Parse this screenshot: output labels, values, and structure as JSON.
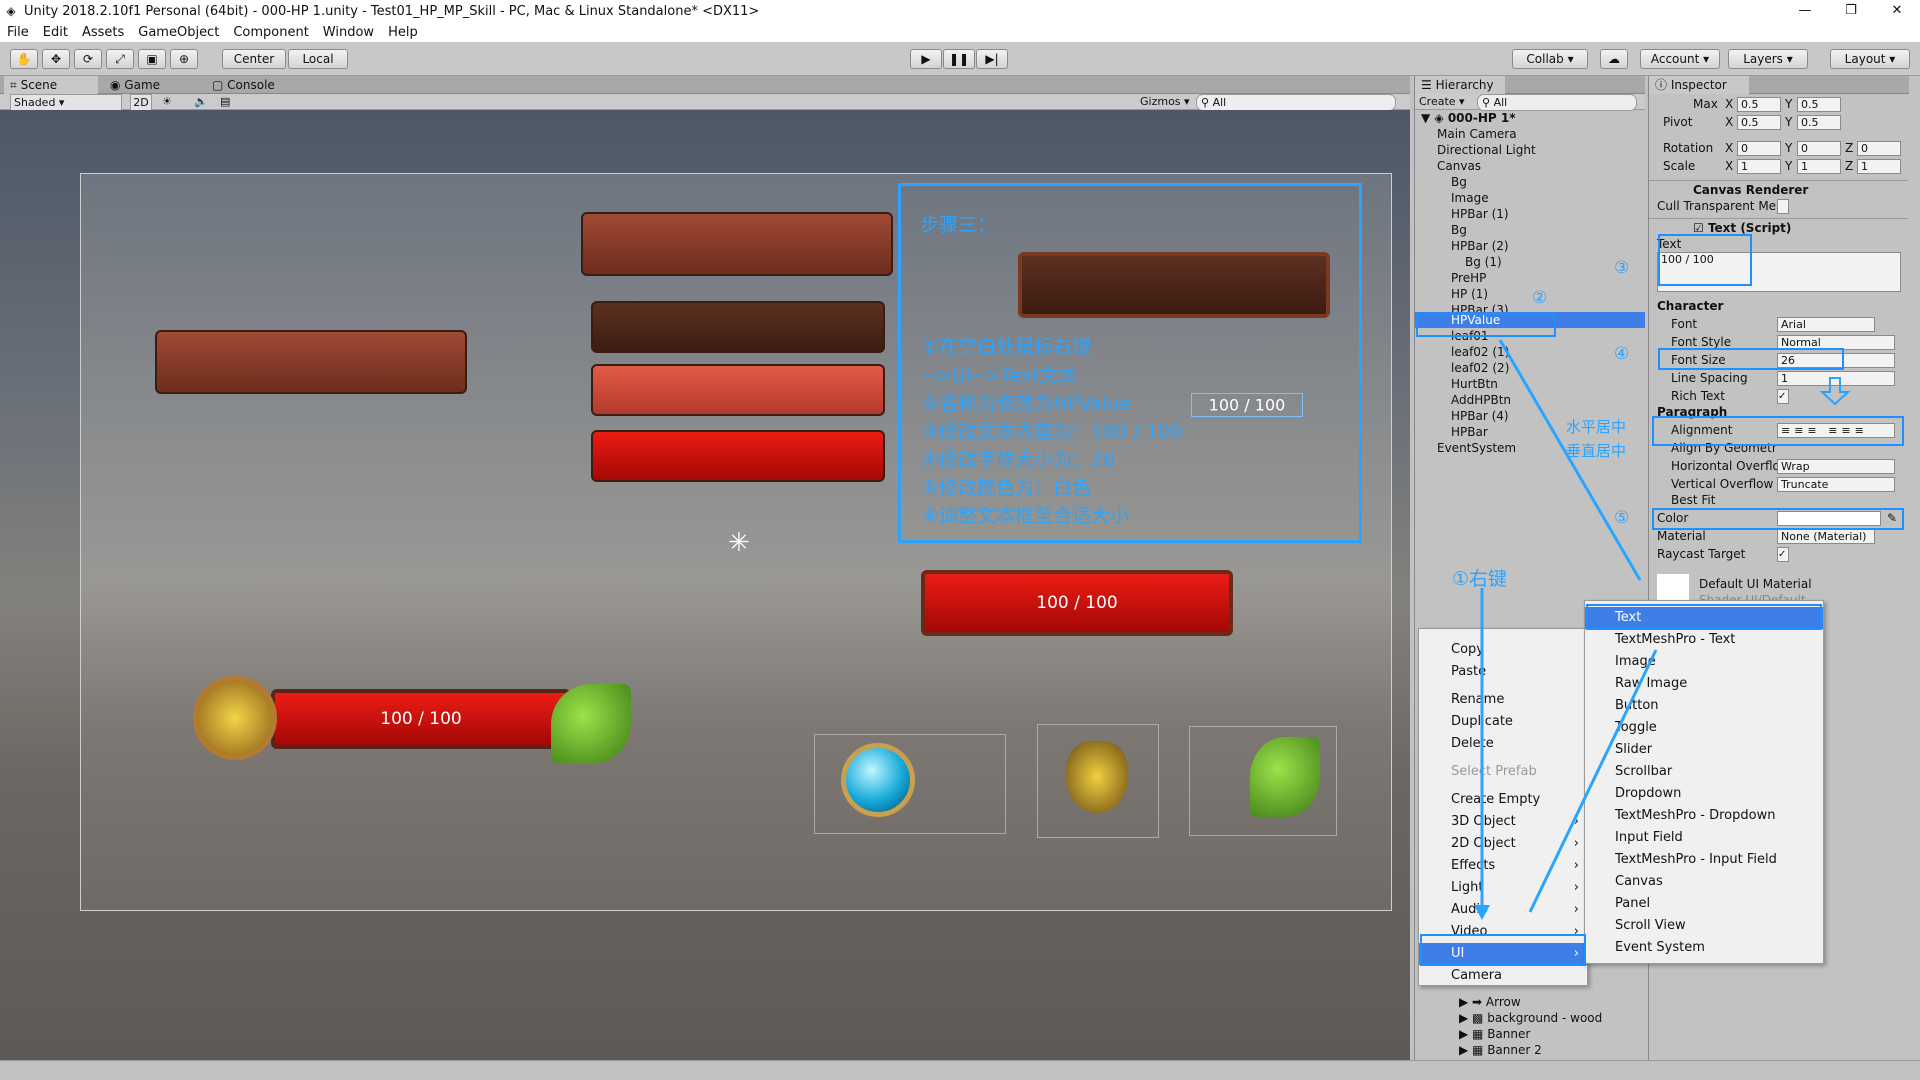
{
  "window": {
    "title": "Unity 2018.2.10f1 Personal (64bit) - 000-HP 1.unity - Test01_HP_MP_Skill - PC, Mac & Linux Standalone* <DX11>",
    "minimize": "—",
    "maximize": "❐",
    "close": "✕"
  },
  "menu": [
    "File",
    "Edit",
    "Assets",
    "GameObject",
    "Component",
    "Window",
    "Help"
  ],
  "toolbar": {
    "center": "Center",
    "local": "Local",
    "collab": "Collab ▾",
    "account": "Account",
    "layers": "Layers",
    "layout": "Layout"
  },
  "scene_tabs": {
    "scene": "Scene",
    "game": "Game",
    "console": "Console"
  },
  "scene_bar": {
    "shaded": "Shaded",
    "mode2d": "2D",
    "gizmos": "Gizmos",
    "search": "All"
  },
  "scene": {
    "hp_text_small": "100 / 100",
    "hp_text_big": "100 / 100",
    "hp_text_main": "100 / 100"
  },
  "annotation": {
    "title": "步骤三：",
    "lines": [
      "①在空白处鼠标右键",
      "-->UI-->Text文本",
      "②名称为修改为HPValue",
      "③修改文本内容为：100 / 100",
      "④修改字体大小为：26",
      "⑤修改颜色为：白色",
      "⑥调整文本框至合适大小"
    ],
    "mark1": "①右键",
    "mark2": "②",
    "mark3": "③",
    "mark4": "④",
    "mark5": "⑤",
    "align_note1": "水平居中",
    "align_note2": "垂直居中"
  },
  "hierarchy": {
    "tab": "Hierarchy",
    "create": "Create ▾",
    "search": "All",
    "scene_name": "000-HP 1*",
    "items": [
      {
        "label": "Main Camera",
        "indent": 1
      },
      {
        "label": "Directional Light",
        "indent": 1
      },
      {
        "label": "Canvas",
        "indent": 1
      },
      {
        "label": "Bg",
        "indent": 2
      },
      {
        "label": "Image",
        "indent": 2
      },
      {
        "label": "HPBar (1)",
        "indent": 2
      },
      {
        "label": "Bg",
        "indent": 2
      },
      {
        "label": "HPBar (2)",
        "indent": 2
      },
      {
        "label": "Bg (1)",
        "indent": 3
      },
      {
        "label": "PreHP",
        "indent": 2
      },
      {
        "label": "HP (1)",
        "indent": 2
      },
      {
        "label": "HPBar (3)",
        "indent": 2
      },
      {
        "label": "HPValue",
        "indent": 2,
        "selected": true
      },
      {
        "label": "leaf01",
        "indent": 2
      },
      {
        "label": "leaf02 (1)",
        "indent": 2
      },
      {
        "label": "leaf02 (2)",
        "indent": 2
      },
      {
        "label": "HurtBtn",
        "indent": 2
      },
      {
        "label": "AddHPBtn",
        "indent": 2
      },
      {
        "label": "HPBar (4)",
        "indent": 2
      },
      {
        "label": "HPBar",
        "indent": 2
      },
      {
        "label": "EventSystem",
        "indent": 1
      }
    ],
    "project_items": [
      "Arrow",
      "background - wood",
      "Banner",
      "Banner 2"
    ]
  },
  "inspector": {
    "tab": "Inspector",
    "rect": {
      "max_x": "0.5",
      "max_y": "0.5",
      "pivot_x": "0.5",
      "pivot_y": "0.5",
      "rot_x": "0",
      "rot_y": "0",
      "rot_z": "0",
      "scale_x": "1",
      "scale_y": "1",
      "scale_z": "1"
    },
    "labels": {
      "max": "Max",
      "pivot": "Pivot",
      "rotation": "Rotation",
      "scale": "Scale",
      "x": "X",
      "y": "Y",
      "z": "Z"
    },
    "canvas_renderer": "Canvas Renderer",
    "cull": "Cull Transparent Me",
    "text_script": "Text (Script)",
    "text_label": "Text",
    "text_value": "100 / 100",
    "character": "Character",
    "font_label": "Font",
    "font_value": "Arial",
    "font_style_label": "Font Style",
    "font_style_value": "Normal",
    "font_size_label": "Font Size",
    "font_size_value": "26",
    "line_spacing_label": "Line Spacing",
    "line_spacing_value": "1",
    "rich_text_label": "Rich Text",
    "paragraph": "Paragraph",
    "alignment_label": "Alignment",
    "align_geo": "Align By Geometr",
    "h_overflow_label": "Horizontal Overflo",
    "h_overflow_value": "Wrap",
    "v_overflow_label": "Vertical Overflow",
    "v_overflow_value": "Truncate",
    "best_fit": "Best Fit",
    "color_label": "Color",
    "material_label": "Material",
    "material_value": "None (Material)",
    "raycast_label": "Raycast Target",
    "default_mat": "Default UI Material",
    "shader": "Shader   UI/Default"
  },
  "context_menu": {
    "items": [
      {
        "label": "Copy"
      },
      {
        "label": "Paste"
      },
      {
        "label": "Rename"
      },
      {
        "label": "Duplicate"
      },
      {
        "label": "Delete"
      },
      {
        "label": "Select Prefab",
        "disabled": true
      },
      {
        "label": "Create Empty"
      },
      {
        "label": "3D Object",
        "sub": true
      },
      {
        "label": "2D Object",
        "sub": true
      },
      {
        "label": "Effects",
        "sub": true
      },
      {
        "label": "Light",
        "sub": true
      },
      {
        "label": "Audio",
        "sub": true
      },
      {
        "label": "Video",
        "sub": true
      },
      {
        "label": "UI",
        "sub": true,
        "selected": true
      },
      {
        "label": "Camera"
      }
    ],
    "submenu": [
      "Text",
      "TextMeshPro - Text",
      "Image",
      "Raw Image",
      "Button",
      "Toggle",
      "Slider",
      "Scrollbar",
      "Dropdown",
      "TextMeshPro - Dropdown",
      "Input Field",
      "TextMeshPro - Input Field",
      "Canvas",
      "Panel",
      "Scroll View",
      "Event System"
    ]
  },
  "colors": {
    "accent": "#2aa4ff",
    "selection": "#3d7ee8",
    "hp_red": "#e0120c",
    "panel": "#c2c2c2"
  }
}
